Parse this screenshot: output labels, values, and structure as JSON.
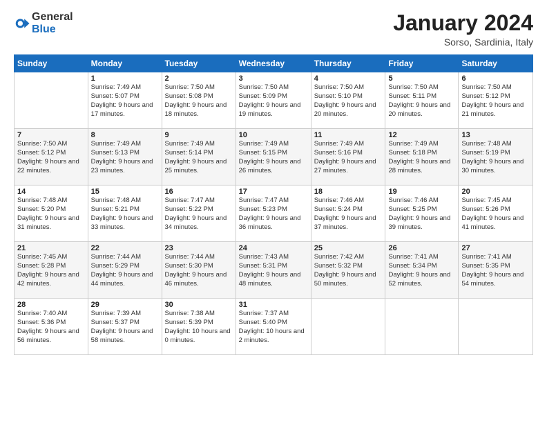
{
  "logo": {
    "general": "General",
    "blue": "Blue"
  },
  "header": {
    "month": "January 2024",
    "location": "Sorso, Sardinia, Italy"
  },
  "weekdays": [
    "Sunday",
    "Monday",
    "Tuesday",
    "Wednesday",
    "Thursday",
    "Friday",
    "Saturday"
  ],
  "weeks": [
    [
      {
        "day": "",
        "sunrise": "",
        "sunset": "",
        "daylight": ""
      },
      {
        "day": "1",
        "sunrise": "Sunrise: 7:49 AM",
        "sunset": "Sunset: 5:07 PM",
        "daylight": "Daylight: 9 hours and 17 minutes."
      },
      {
        "day": "2",
        "sunrise": "Sunrise: 7:50 AM",
        "sunset": "Sunset: 5:08 PM",
        "daylight": "Daylight: 9 hours and 18 minutes."
      },
      {
        "day": "3",
        "sunrise": "Sunrise: 7:50 AM",
        "sunset": "Sunset: 5:09 PM",
        "daylight": "Daylight: 9 hours and 19 minutes."
      },
      {
        "day": "4",
        "sunrise": "Sunrise: 7:50 AM",
        "sunset": "Sunset: 5:10 PM",
        "daylight": "Daylight: 9 hours and 20 minutes."
      },
      {
        "day": "5",
        "sunrise": "Sunrise: 7:50 AM",
        "sunset": "Sunset: 5:11 PM",
        "daylight": "Daylight: 9 hours and 20 minutes."
      },
      {
        "day": "6",
        "sunrise": "Sunrise: 7:50 AM",
        "sunset": "Sunset: 5:12 PM",
        "daylight": "Daylight: 9 hours and 21 minutes."
      }
    ],
    [
      {
        "day": "7",
        "sunrise": "Sunrise: 7:50 AM",
        "sunset": "Sunset: 5:12 PM",
        "daylight": "Daylight: 9 hours and 22 minutes."
      },
      {
        "day": "8",
        "sunrise": "Sunrise: 7:49 AM",
        "sunset": "Sunset: 5:13 PM",
        "daylight": "Daylight: 9 hours and 23 minutes."
      },
      {
        "day": "9",
        "sunrise": "Sunrise: 7:49 AM",
        "sunset": "Sunset: 5:14 PM",
        "daylight": "Daylight: 9 hours and 25 minutes."
      },
      {
        "day": "10",
        "sunrise": "Sunrise: 7:49 AM",
        "sunset": "Sunset: 5:15 PM",
        "daylight": "Daylight: 9 hours and 26 minutes."
      },
      {
        "day": "11",
        "sunrise": "Sunrise: 7:49 AM",
        "sunset": "Sunset: 5:16 PM",
        "daylight": "Daylight: 9 hours and 27 minutes."
      },
      {
        "day": "12",
        "sunrise": "Sunrise: 7:49 AM",
        "sunset": "Sunset: 5:18 PM",
        "daylight": "Daylight: 9 hours and 28 minutes."
      },
      {
        "day": "13",
        "sunrise": "Sunrise: 7:48 AM",
        "sunset": "Sunset: 5:19 PM",
        "daylight": "Daylight: 9 hours and 30 minutes."
      }
    ],
    [
      {
        "day": "14",
        "sunrise": "Sunrise: 7:48 AM",
        "sunset": "Sunset: 5:20 PM",
        "daylight": "Daylight: 9 hours and 31 minutes."
      },
      {
        "day": "15",
        "sunrise": "Sunrise: 7:48 AM",
        "sunset": "Sunset: 5:21 PM",
        "daylight": "Daylight: 9 hours and 33 minutes."
      },
      {
        "day": "16",
        "sunrise": "Sunrise: 7:47 AM",
        "sunset": "Sunset: 5:22 PM",
        "daylight": "Daylight: 9 hours and 34 minutes."
      },
      {
        "day": "17",
        "sunrise": "Sunrise: 7:47 AM",
        "sunset": "Sunset: 5:23 PM",
        "daylight": "Daylight: 9 hours and 36 minutes."
      },
      {
        "day": "18",
        "sunrise": "Sunrise: 7:46 AM",
        "sunset": "Sunset: 5:24 PM",
        "daylight": "Daylight: 9 hours and 37 minutes."
      },
      {
        "day": "19",
        "sunrise": "Sunrise: 7:46 AM",
        "sunset": "Sunset: 5:25 PM",
        "daylight": "Daylight: 9 hours and 39 minutes."
      },
      {
        "day": "20",
        "sunrise": "Sunrise: 7:45 AM",
        "sunset": "Sunset: 5:26 PM",
        "daylight": "Daylight: 9 hours and 41 minutes."
      }
    ],
    [
      {
        "day": "21",
        "sunrise": "Sunrise: 7:45 AM",
        "sunset": "Sunset: 5:28 PM",
        "daylight": "Daylight: 9 hours and 42 minutes."
      },
      {
        "day": "22",
        "sunrise": "Sunrise: 7:44 AM",
        "sunset": "Sunset: 5:29 PM",
        "daylight": "Daylight: 9 hours and 44 minutes."
      },
      {
        "day": "23",
        "sunrise": "Sunrise: 7:44 AM",
        "sunset": "Sunset: 5:30 PM",
        "daylight": "Daylight: 9 hours and 46 minutes."
      },
      {
        "day": "24",
        "sunrise": "Sunrise: 7:43 AM",
        "sunset": "Sunset: 5:31 PM",
        "daylight": "Daylight: 9 hours and 48 minutes."
      },
      {
        "day": "25",
        "sunrise": "Sunrise: 7:42 AM",
        "sunset": "Sunset: 5:32 PM",
        "daylight": "Daylight: 9 hours and 50 minutes."
      },
      {
        "day": "26",
        "sunrise": "Sunrise: 7:41 AM",
        "sunset": "Sunset: 5:34 PM",
        "daylight": "Daylight: 9 hours and 52 minutes."
      },
      {
        "day": "27",
        "sunrise": "Sunrise: 7:41 AM",
        "sunset": "Sunset: 5:35 PM",
        "daylight": "Daylight: 9 hours and 54 minutes."
      }
    ],
    [
      {
        "day": "28",
        "sunrise": "Sunrise: 7:40 AM",
        "sunset": "Sunset: 5:36 PM",
        "daylight": "Daylight: 9 hours and 56 minutes."
      },
      {
        "day": "29",
        "sunrise": "Sunrise: 7:39 AM",
        "sunset": "Sunset: 5:37 PM",
        "daylight": "Daylight: 9 hours and 58 minutes."
      },
      {
        "day": "30",
        "sunrise": "Sunrise: 7:38 AM",
        "sunset": "Sunset: 5:39 PM",
        "daylight": "Daylight: 10 hours and 0 minutes."
      },
      {
        "day": "31",
        "sunrise": "Sunrise: 7:37 AM",
        "sunset": "Sunset: 5:40 PM",
        "daylight": "Daylight: 10 hours and 2 minutes."
      },
      {
        "day": "",
        "sunrise": "",
        "sunset": "",
        "daylight": ""
      },
      {
        "day": "",
        "sunrise": "",
        "sunset": "",
        "daylight": ""
      },
      {
        "day": "",
        "sunrise": "",
        "sunset": "",
        "daylight": ""
      }
    ]
  ]
}
